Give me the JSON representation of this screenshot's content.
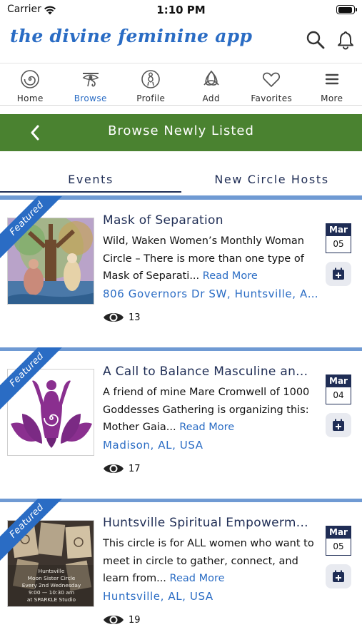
{
  "status_bar": {
    "carrier": "Carrier",
    "time": "1:10 PM"
  },
  "header": {
    "app_title": "the divine feminine app"
  },
  "nav": {
    "items": [
      {
        "label": "Home",
        "icon": "spiral-icon",
        "active": false
      },
      {
        "label": "Browse",
        "icon": "eye-of-horus-icon",
        "active": true
      },
      {
        "label": "Profile",
        "icon": "goddess-icon",
        "active": false
      },
      {
        "label": "Add",
        "icon": "triquetra-icon",
        "active": false
      },
      {
        "label": "Favorites",
        "icon": "heart-icon",
        "active": false
      },
      {
        "label": "More",
        "icon": "menu-icon",
        "active": false
      }
    ]
  },
  "title_bar": {
    "title": "Browse Newly Listed"
  },
  "segments": {
    "events": "Events",
    "hosts": "New Circle Hosts",
    "active": "Events"
  },
  "featured_label": "Featured",
  "cards": [
    {
      "title": "Mask of Separation",
      "description": "Wild, Waken Women’s Monthly Woman Circle – There is more than one type of Mask of Separati...",
      "read_more": "Read More",
      "location": "806 Governors Dr SW, Huntsville, A...",
      "views": "13",
      "month": "Mar",
      "day": "05"
    },
    {
      "title": "A Call to Balance Masculine an...",
      "description": "A friend of mine Mare Cromwell of 1000 Goddesses Gathering is organizing this: Mother Gaia...",
      "read_more": "Read More",
      "location": "Madison, AL, USA",
      "views": "17",
      "month": "Mar",
      "day": "04"
    },
    {
      "title": "Huntsville Spiritual Empowerm...",
      "description": "This circle is for ALL women who want to meet in circle to gather, connect, and learn from...",
      "read_more": "Read More",
      "location": "Huntsville, AL, USA",
      "views": "19",
      "month": "Mar",
      "day": "05",
      "thumb_text": [
        "Huntsville",
        "Moon Sister Circle",
        "Every 2nd Wednesday",
        "9:00 — 10:30 am",
        "at SPARKLE Studio"
      ]
    }
  ],
  "colors": {
    "accent_blue": "#2a6cc4",
    "navy": "#1f2d55",
    "green_bar": "#4a8230",
    "rule_blue": "#6f9ad3"
  }
}
